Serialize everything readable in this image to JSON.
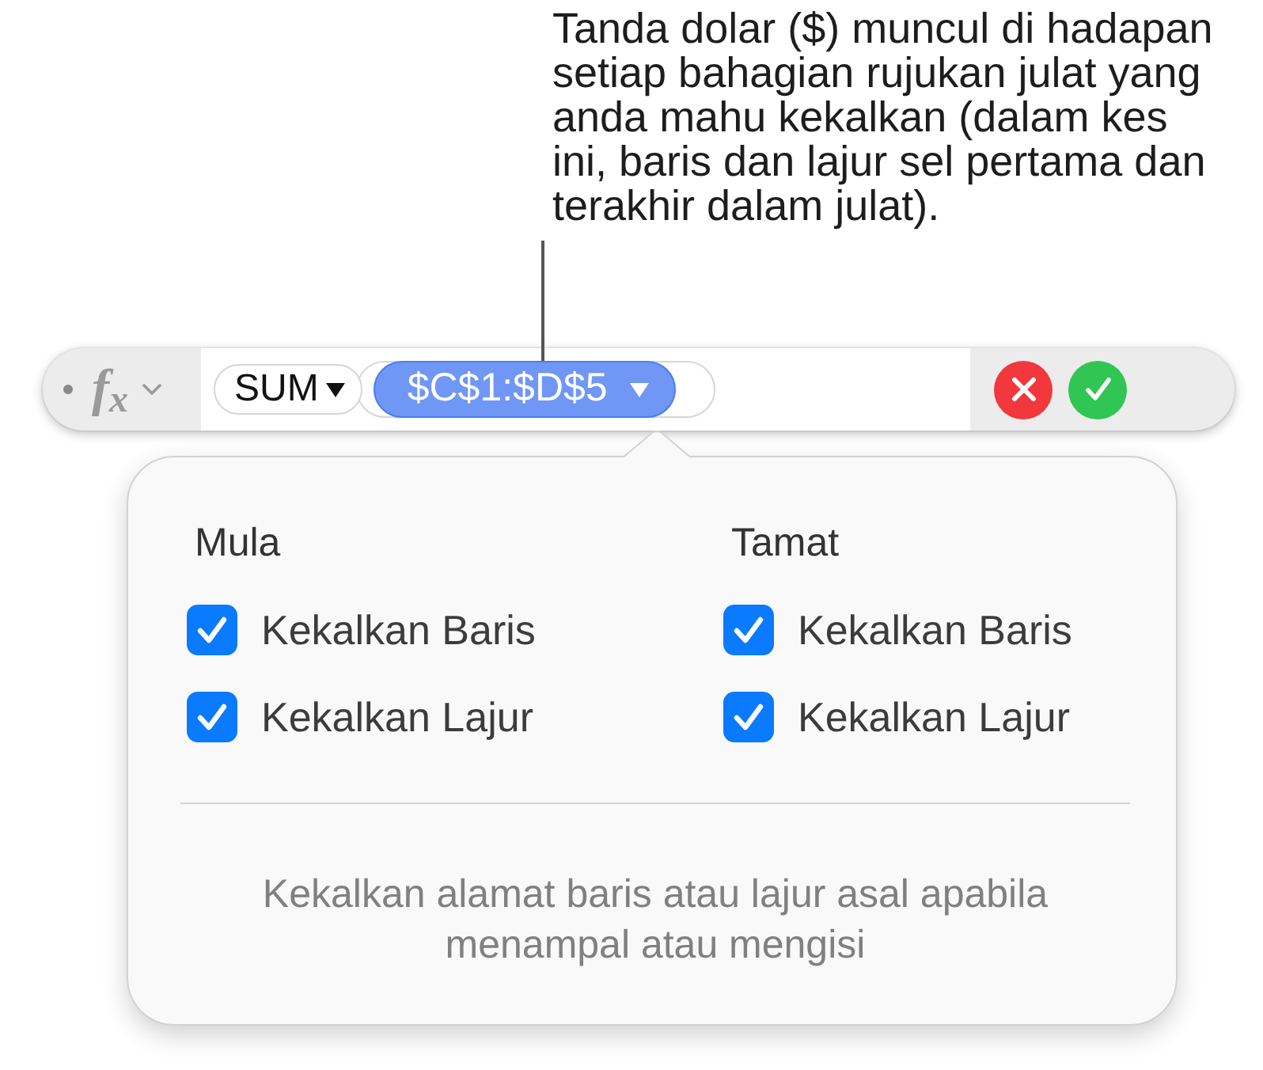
{
  "callout": {
    "text": "Tanda dolar ($) muncul di hadapan setiap bahagian rujukan julat yang anda mahu kekalkan (dalam kes ini, baris dan lajur sel pertama dan terakhir dalam julat)."
  },
  "formula_bar": {
    "function_button": "f$_{x}$",
    "tokens": [
      {
        "kind": "function",
        "text": "SUM",
        "selected": false
      },
      {
        "kind": "range",
        "text": "$C$1:$D$5",
        "selected": true
      }
    ]
  },
  "popover": {
    "columns": [
      {
        "heading": "Mula",
        "options": [
          {
            "label": "Kekalkan Baris",
            "checked": true
          },
          {
            "label": "Kekalkan Lajur",
            "checked": true
          }
        ]
      },
      {
        "heading": "Tamat",
        "options": [
          {
            "label": "Kekalkan Baris",
            "checked": true
          },
          {
            "label": "Kekalkan Lajur",
            "checked": true
          }
        ]
      }
    ],
    "note": "Kekalkan alamat baris atau lajur asal apabila menampal atau mengisi"
  }
}
